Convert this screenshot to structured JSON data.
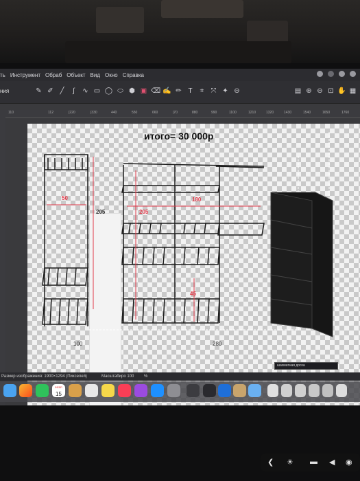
{
  "menu": {
    "items": [
      "Инструмент",
      "Обраб",
      "Объект",
      "Вид",
      "Окно",
      "Справка"
    ],
    "first_partial": "ть"
  },
  "toolbar": {
    "panel_title": "ния",
    "tools": [
      "eyedropper",
      "pen-slash",
      "line",
      "curve",
      "wave",
      "rectangle",
      "ellipse",
      "ellipse-alt",
      "polygon",
      "fill",
      "eraser",
      "brush",
      "pencil",
      "text",
      "crop",
      "transform",
      "magic-wand",
      "selection"
    ]
  },
  "ruler": {
    "ticks": [
      "110",
      "112",
      "|220",
      "|330",
      "440",
      "550",
      "660",
      "|70",
      "880",
      "990",
      "1100",
      "1210",
      "1320",
      "1430",
      "1540",
      "1650",
      "1760"
    ]
  },
  "canvas": {
    "total_label": "итого= 30 000р",
    "dims": {
      "w50": "50",
      "h205": "205",
      "h205b": "205",
      "w180": "180",
      "h45": "45",
      "w100": "100",
      "w280": "280"
    }
  },
  "status": {
    "image_size": "Размер изображения: 1900×1294 (Пикселей)",
    "zoom_label": "Масштабиро 100",
    "zoom_unit": "%",
    "layer": "шахматная доска"
  },
  "dock": {
    "calendar_day": "15",
    "calendar_month": "ФЕВР."
  },
  "colors": {
    "dimension_red": "#e23a4a",
    "menubar": "#2c2c30"
  }
}
